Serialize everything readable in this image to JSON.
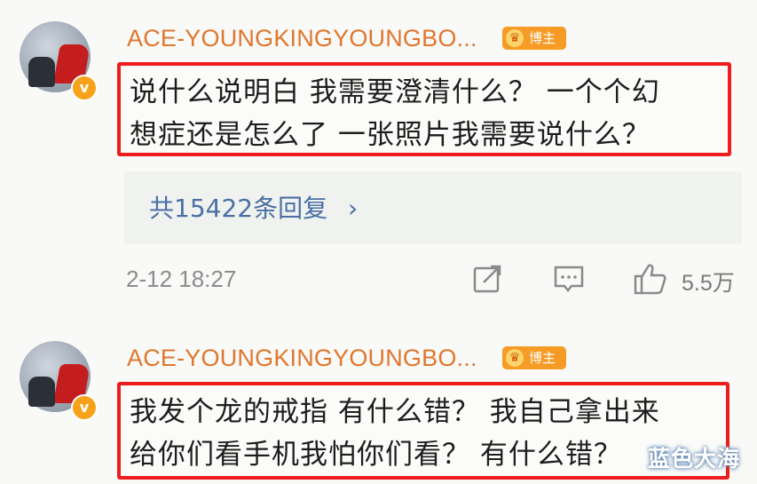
{
  "comments": [
    {
      "username": "ACE-YOUNGKINGYOUNGBO...",
      "badge_icon": "verified-v-icon",
      "blogger_badge": "博主",
      "text_line1": "说什么说明白 我需要澄清什么？ 一个个幻",
      "text_line2": "想症还是怎么了 一张照片我需要说什么？",
      "replies": "共15422条回复",
      "replies_arrow": "›",
      "timestamp": "2-12 18:27",
      "likes": "5.5万"
    },
    {
      "username": "ACE-YOUNGKINGYOUNGBO...",
      "badge_icon": "verified-v-icon",
      "blogger_badge": "博主",
      "text_line1": "我发个龙的戒指 有什么错？ 我自己拿出来",
      "text_line2": "给你们看手机我怕你们看？ 有什么错？"
    }
  ],
  "watermark": "蓝色大海",
  "colors": {
    "username": "#e0762d",
    "highlight_border": "#ee1c1c",
    "replies_link": "#4a6fa5",
    "badge": "#f59b26"
  }
}
